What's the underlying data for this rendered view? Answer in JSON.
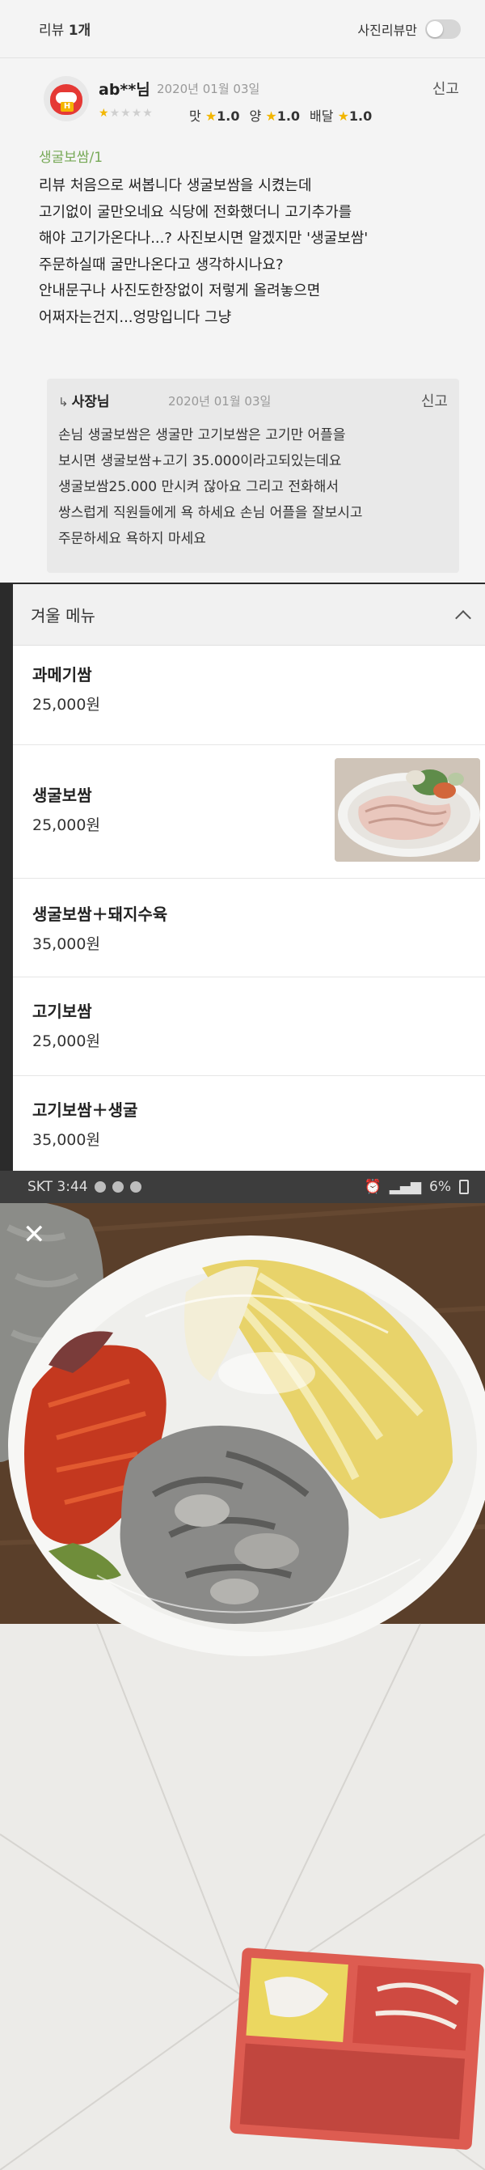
{
  "review_header": {
    "count_prefix": "리뷰 ",
    "count": "1개",
    "photo_only_label": "사진리뷰만"
  },
  "review": {
    "author": "ab**님",
    "date": "2020년 01월 03일",
    "report_label": "신고",
    "rating": 1,
    "scores": [
      {
        "label": "맛",
        "value": "1.0"
      },
      {
        "label": "양",
        "value": "1.0"
      },
      {
        "label": "배달",
        "value": "1.0"
      }
    ],
    "ordered_menu": "생굴보쌈/1",
    "lines": [
      "리뷰 처음으로 써봅니다 생굴보쌈을 시켰는데",
      "고기없이 굴만오네요 식당에 전화했더니 고기추가를",
      "해야 고기가온다나...? 사진보시면 알겠지만 '생굴보쌈'",
      "주문하실때 굴만나온다고 생각하시나요?",
      "안내문구나 사진도한장없이 저렇게 올려놓으면",
      "어쩌자는건지...엉망입니다 그냥"
    ]
  },
  "owner_reply": {
    "name": "사장님",
    "date": "2020년 01월 03일",
    "report_label": "신고",
    "lines": [
      "손님 생굴보쌈은 생굴만 고기보쌈은 고기만 어플을",
      "보시면 생굴보쌈+고기 35.000이라고되있는데요",
      "생굴보쌈25.000 만시켜 잖아요 그리고 전화해서",
      "쌍스럽게 직원들에게 욕 하세요 손님 어플을 잘보시고",
      "주문하세요 욕하지 마세요"
    ]
  },
  "winter_menu": {
    "title": "겨울 메뉴",
    "items": [
      {
        "name": "과메기쌈",
        "price": "25,000원"
      },
      {
        "name": "생굴보쌈",
        "price": "25,000원",
        "has_photo": true
      },
      {
        "name": "생굴보쌈＋돼지수육",
        "price": "35,000원"
      },
      {
        "name": "고기보쌈",
        "price": "25,000원"
      },
      {
        "name": "고기보쌈＋생굴",
        "price": "35,000원"
      }
    ]
  },
  "photo_viewer": {
    "carrier_time": "SKT 3:44",
    "battery": "6%"
  },
  "colors": {
    "star": "#f2b600",
    "menu_tag": "#77a957"
  }
}
